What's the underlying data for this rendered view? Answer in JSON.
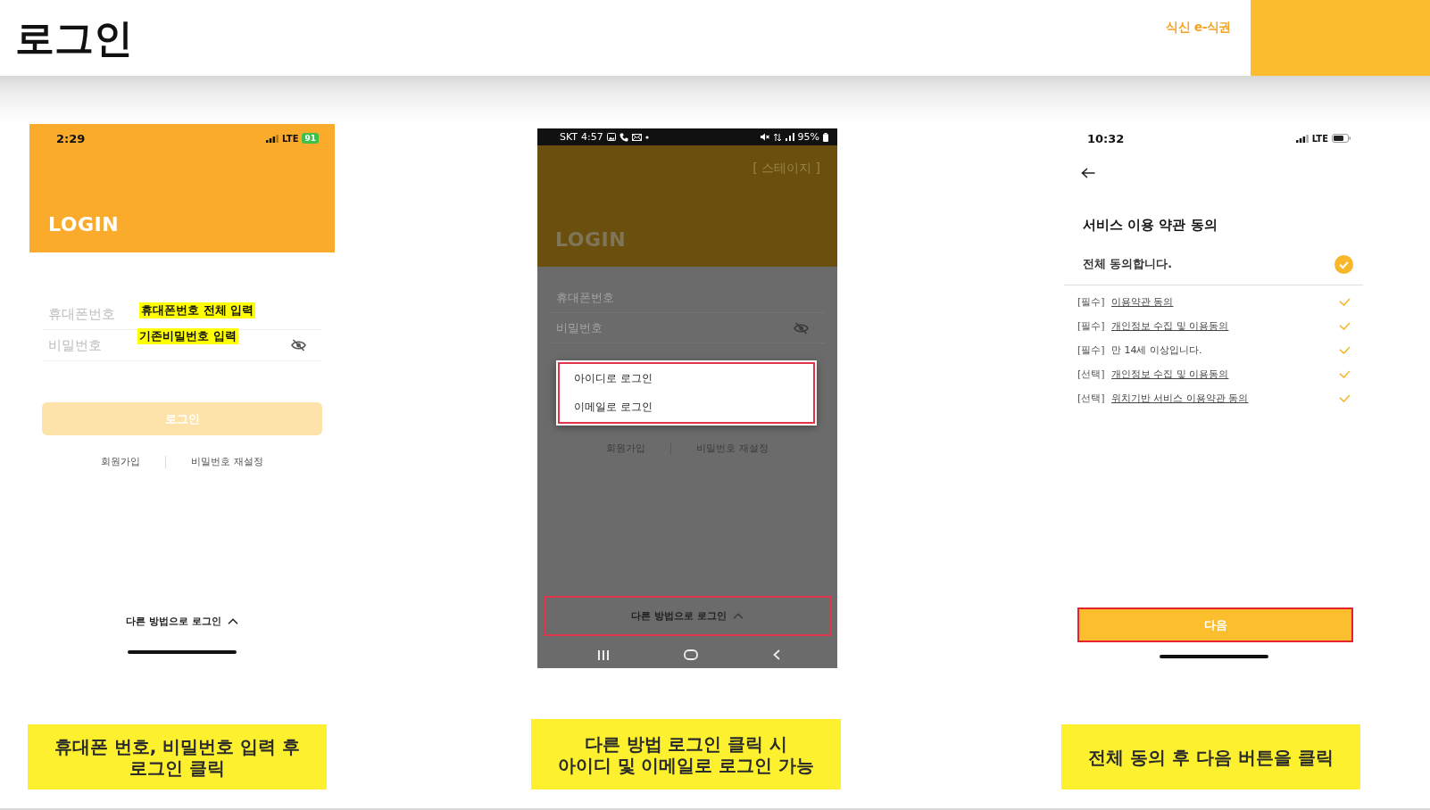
{
  "header": {
    "title": "로그인",
    "logo": "식신 e-식권"
  },
  "screens": [
    {
      "kind": "login",
      "dimmed": false,
      "status_bar": {
        "kind": "ios",
        "time": "2:29",
        "network": "LTE",
        "battery": "91",
        "charging": true
      },
      "heading": "LOGIN",
      "fields": [
        {
          "kind": "text",
          "placeholder": "휴대폰번호",
          "annotation": "휴대폰번호 전체 입력"
        },
        {
          "kind": "password",
          "placeholder": "비밀번호",
          "annotation": "기존비밀번호 입력"
        }
      ],
      "login_button": {
        "label": "로그인",
        "disabled": true
      },
      "links": [
        "회원가입",
        "비밀번호 재설정"
      ],
      "other_login": {
        "label": "다른 방법으로 로그인",
        "highlighted": false
      }
    },
    {
      "kind": "login",
      "dimmed": true,
      "status_bar": {
        "kind": "android",
        "carrier": "SKT",
        "time": "4:57",
        "battery": "95%"
      },
      "stage_label": "[ 스테이지 ]",
      "heading": "LOGIN",
      "fields": [
        {
          "kind": "text",
          "placeholder": "휴대폰번호"
        },
        {
          "kind": "password",
          "placeholder": "비밀번호"
        }
      ],
      "options_menu": {
        "items": [
          "아이디로 로그인",
          "이메일로 로그인"
        ],
        "highlighted": true
      },
      "links": [
        "회원가입",
        "비밀번호 재설정"
      ],
      "other_login": {
        "label": "다른 방법으로 로그인",
        "highlighted": true
      }
    },
    {
      "kind": "terms",
      "status_bar": {
        "kind": "ios",
        "time": "10:32",
        "network": "LTE"
      },
      "title": "서비스 이용 약관 동의",
      "agree_all": {
        "label": "전체 동의합니다.",
        "checked": true
      },
      "terms": [
        {
          "kind": "link",
          "tag": "[필수]",
          "label": "이용약관 동의",
          "checked": true
        },
        {
          "kind": "link",
          "tag": "[필수]",
          "label": "개인정보 수집 및 이용동의",
          "checked": true
        },
        {
          "kind": "text",
          "tag": "[필수]",
          "label": "만 14세 이상입니다.",
          "checked": true
        },
        {
          "kind": "link",
          "tag": "[선택]",
          "label": "개인정보 수집 및 이용동의",
          "checked": true
        },
        {
          "kind": "link",
          "tag": "[선택]",
          "label": "위치기반 서비스 이용약관 동의",
          "checked": true
        }
      ],
      "next_button": {
        "label": "다음",
        "highlighted": true
      }
    }
  ],
  "captions": [
    "휴대폰 번호, 비밀번호 입력 후\n로그인 클릭",
    "다른 방법 로그인 클릭 시\n아이디 및 이메일로 로그인 가능",
    "전체 동의 후 다음 버튼을 클릭"
  ]
}
